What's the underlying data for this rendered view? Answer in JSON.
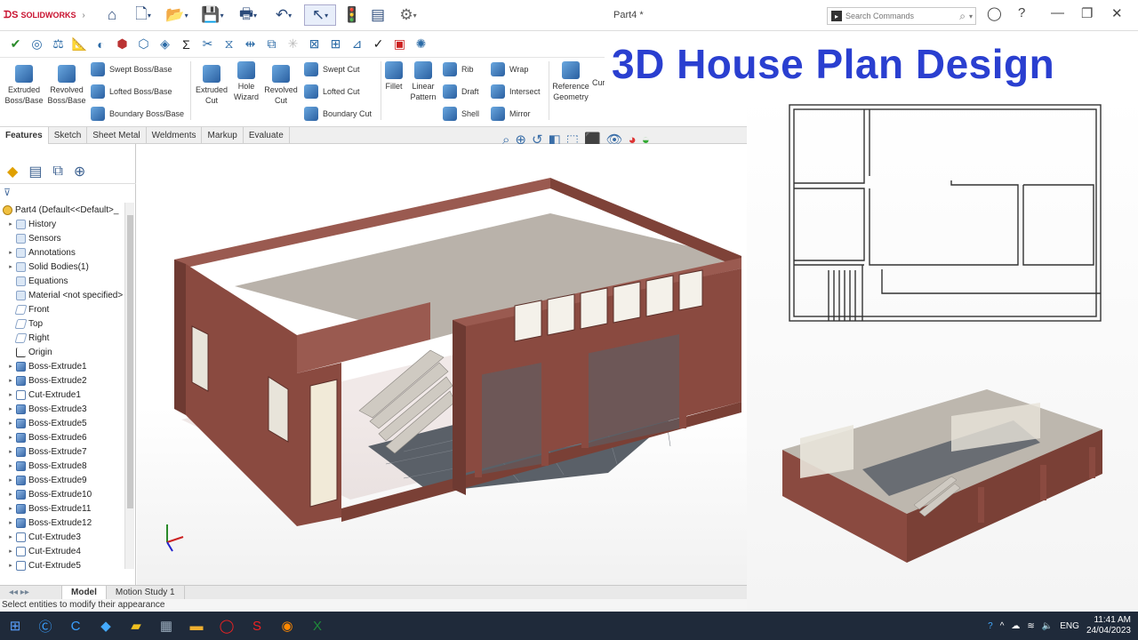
{
  "app": {
    "logo_text": "SOLIDWORKS",
    "doc_title": "Part4 *"
  },
  "search": {
    "placeholder": "Search Commands"
  },
  "quick_access": [
    "home-icon",
    "new-document-icon",
    "open-icon",
    "save-icon",
    "print-icon",
    "undo-icon",
    "select-icon",
    "rebuild-icon",
    "file-properties-icon",
    "options-icon"
  ],
  "ribbon": {
    "extruded_boss": "Extruded Boss/Base",
    "revolved_boss": "Revolved Boss/Base",
    "swept_boss": "Swept Boss/Base",
    "lofted_boss": "Lofted Boss/Base",
    "boundary_boss": "Boundary Boss/Base",
    "extruded_cut": "Extruded Cut",
    "hole_wizard": "Hole Wizard",
    "revolved_cut": "Revolved Cut",
    "swept_cut": "Swept Cut",
    "lofted_cut": "Lofted Cut",
    "boundary_cut": "Boundary Cut",
    "fillet": "Fillet",
    "linear_pattern": "Linear Pattern",
    "rib": "Rib",
    "draft": "Draft",
    "shell": "Shell",
    "wrap": "Wrap",
    "intersect": "Intersect",
    "mirror": "Mirror",
    "reference_geometry": "Reference Geometry",
    "curves": "Cur"
  },
  "tabs": [
    "Features",
    "Sketch",
    "Sheet Metal",
    "Weldments",
    "Markup",
    "Evaluate"
  ],
  "tree": {
    "root": "Part4  (Default<<Default>_",
    "items": [
      "History",
      "Sensors",
      "Annotations",
      "Solid Bodies(1)",
      "Equations",
      "Material <not specified>",
      "Front",
      "Top",
      "Right",
      "Origin",
      "Boss-Extrude1",
      "Boss-Extrude2",
      "Cut-Extrude1",
      "Boss-Extrude3",
      "Boss-Extrude5",
      "Boss-Extrude6",
      "Boss-Extrude7",
      "Boss-Extrude8",
      "Boss-Extrude9",
      "Boss-Extrude10",
      "Boss-Extrude11",
      "Boss-Extrude12",
      "Cut-Extrude3",
      "Cut-Extrude4",
      "Cut-Extrude5"
    ]
  },
  "bottom_tabs": [
    "Model",
    "Motion Study 1"
  ],
  "status": "Select entities to modify their appearance",
  "overlay_title": "3D House Plan Design",
  "taskbar": {
    "time": "11:41 AM",
    "date": "24/04/2023",
    "lang": "ENG"
  },
  "colors": {
    "brick": "#8a4a40",
    "floor": "#5a6068",
    "title_blue": "#2a3fd0"
  }
}
